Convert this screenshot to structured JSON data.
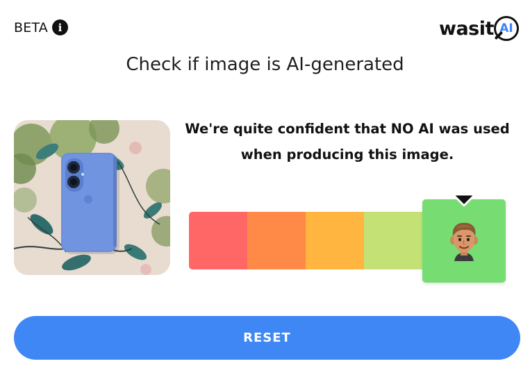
{
  "header": {
    "beta_label": "BETA",
    "info_icon_glyph": "i",
    "logo": {
      "text": "wasit",
      "circle_text": "AI",
      "accent_color": "#3d84f6"
    }
  },
  "main": {
    "title": "Check if image is AI-generated",
    "verdict_line_1": "We're quite confident that NO AI was used",
    "verdict_line_2": "when producing this image.",
    "scale": {
      "segment_colors": [
        "#ff6767",
        "#ff8a47",
        "#ffb53f",
        "#c4e175",
        "#77dd72"
      ],
      "active_index": 4,
      "active_icon": "human-face-icon"
    },
    "thumbnail_icon": "uploaded-photo-phone-on-floral-fabric"
  },
  "actions": {
    "reset_label": "RESET"
  },
  "colors": {
    "button": "#3f87f5",
    "text": "#1e1e1e"
  }
}
